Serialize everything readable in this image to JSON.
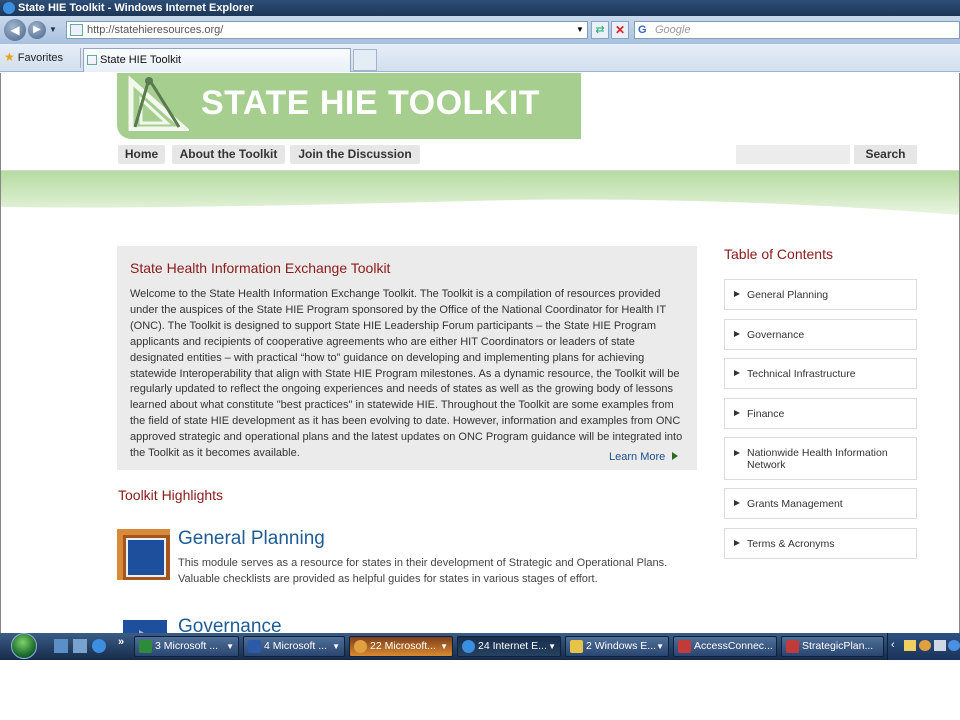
{
  "window": {
    "title": "State HIE Toolkit - Windows Internet Explorer"
  },
  "address_bar": {
    "url": "http://statehieresources.org/",
    "search_placeholder": "Google"
  },
  "favorites_bar": {
    "favorites_label": "Favorites",
    "tab_title": "State HIE Toolkit"
  },
  "site": {
    "banner_title": "STATE HIE TOOLKIT",
    "nav": {
      "home": "Home",
      "about": "About the Toolkit",
      "join": "Join the Discussion"
    },
    "search_button": "Search"
  },
  "welcome": {
    "title": "State Health Information Exchange Toolkit",
    "body": "Welcome to the State Health Information Exchange Toolkit. The Toolkit is a compilation of resources provided under the auspices of the State HIE Program sponsored by the Office of the National Coordinator for Health IT (ONC). The Toolkit is designed to support State HIE Leadership Forum participants – the State HIE Program applicants and recipients of cooperative agreements who are either HIT Coordinators or leaders of state designated entities – with practical “how to” guidance on developing and implementing plans for achieving statewide Interoperability that align with State HIE Program milestones.  As a dynamic resource, the Toolkit will be regularly updated to reflect the ongoing experiences and needs of states as well as the growing body of lessons learned about what constitute \"best practices\" in statewide HIE.  Throughout the Toolkit are some examples from the field of state HIE development as it has been evolving to date.  However, information and examples from ONC approved strategic and operational plans and the latest updates on ONC Program guidance will be integrated into the Toolkit as it becomes available.",
    "learn_more": "Learn More"
  },
  "highlights": {
    "title": "Toolkit Highlights",
    "modules": [
      {
        "title": "General Planning",
        "description": "This module serves as a resource for states in their development of Strategic and Operational Plans. Valuable checklists are provided as helpful guides for states in various stages of effort."
      },
      {
        "title": "Governance",
        "description": ""
      }
    ]
  },
  "toc": {
    "title": "Table of Contents",
    "items": [
      "General Planning",
      "Governance",
      "Technical Infrastructure",
      "Finance",
      "Nationwide Health Information Network",
      "Grants Management",
      "Terms & Acronyms"
    ]
  },
  "taskbar": {
    "buttons": [
      "3 Microsoft ...",
      "4 Microsoft ...",
      "22 Microsoft...",
      "24 Internet E...",
      "2 Windows E...",
      "AccessConnec...",
      "StrategicPlan..."
    ]
  },
  "colors": {
    "banner_green": "#a6cf8f",
    "heading_red": "#8b1a1a",
    "link_blue": "#1f5c96"
  }
}
